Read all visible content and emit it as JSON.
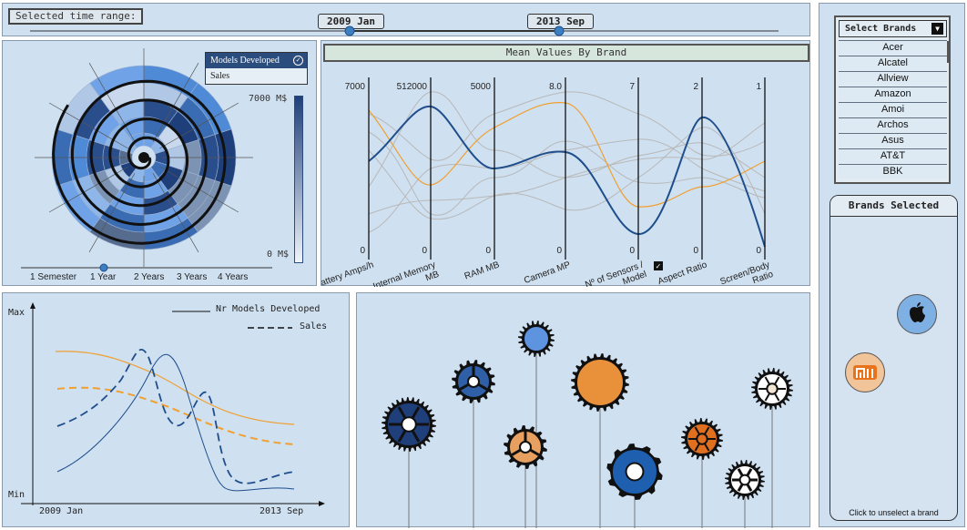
{
  "timeline": {
    "label": "Selected time range:",
    "start": "2009 Jan",
    "end": "2013 Sep"
  },
  "spiral": {
    "dropdown_selected": "Models Developed",
    "dropdown_option": "Sales",
    "legend_max": "7000 M$",
    "legend_min": "0 M$",
    "slider_labels": [
      "1 Semester",
      "1 Year",
      "2 Years",
      "3 Years",
      "4 Years"
    ],
    "slider_value": "1 Year"
  },
  "parallel": {
    "title": "Mean Values By Brand",
    "axes": [
      {
        "label": "Battery Amps/h",
        "max": "7000",
        "min": "0"
      },
      {
        "label": "Internal Memory MB",
        "max": "512000",
        "min": "0"
      },
      {
        "label": "RAM MB",
        "max": "5000",
        "min": "0"
      },
      {
        "label": "Camera MP",
        "max": "8.0",
        "min": "0"
      },
      {
        "label": "Nº of Sensors / Model",
        "max": "7",
        "min": "0"
      },
      {
        "label": "Aspect Ratio",
        "max": "2",
        "min": "0"
      },
      {
        "label": "Screen/Body Ratio",
        "max": "1",
        "min": "0"
      }
    ],
    "colors": {
      "blue": "#1f4e8c",
      "orange": "#f0a030",
      "gray": "#b8b8b8"
    }
  },
  "linechart": {
    "legend_solid": "Nr Models Developed",
    "legend_dashed": "Sales",
    "y_max": "Max",
    "y_min": "Min",
    "x_start": "2009 Jan",
    "x_end": "2013 Sep"
  },
  "brands": {
    "select_label": "Select Brands",
    "list": [
      "Acer",
      "Alcatel",
      "Allview",
      "Amazon",
      "Amoi",
      "Archos",
      "Asus",
      "AT&T",
      "BBK"
    ],
    "selected_title": "Brands Selected",
    "selected_icons": [
      "apple-icon",
      "xiaomi-icon"
    ],
    "hint": "Click to unselect a brand"
  }
}
